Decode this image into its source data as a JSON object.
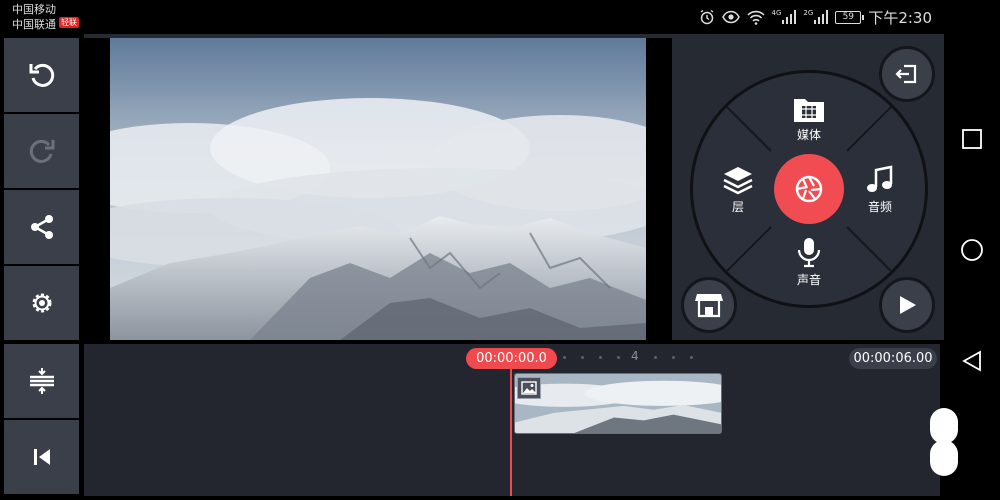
{
  "status_bar": {
    "carrier_1": "中国移动",
    "carrier_2": "中国联通",
    "carrier_badge": "轻联",
    "network_1": "4G",
    "network_2": "2G",
    "battery": "59",
    "time": "下午2:30"
  },
  "toolbar": {
    "undo_icon": "undo-icon",
    "redo_icon": "redo-icon",
    "share_icon": "share-icon",
    "settings_icon": "gear-icon",
    "timeline_expand_icon": "expand-timeline-icon",
    "skip_start_icon": "skip-to-start-icon"
  },
  "wheel": {
    "media_label": "媒体",
    "layer_label": "层",
    "audio_label": "音频",
    "voice_label": "声音"
  },
  "timeline": {
    "current_time": "00:00:00.0",
    "total_time": "00:00:06.00",
    "ruler_mark": "4"
  },
  "colors": {
    "accent": "#f04c52",
    "panel": "#3a3f4a",
    "background": "#23262e"
  }
}
